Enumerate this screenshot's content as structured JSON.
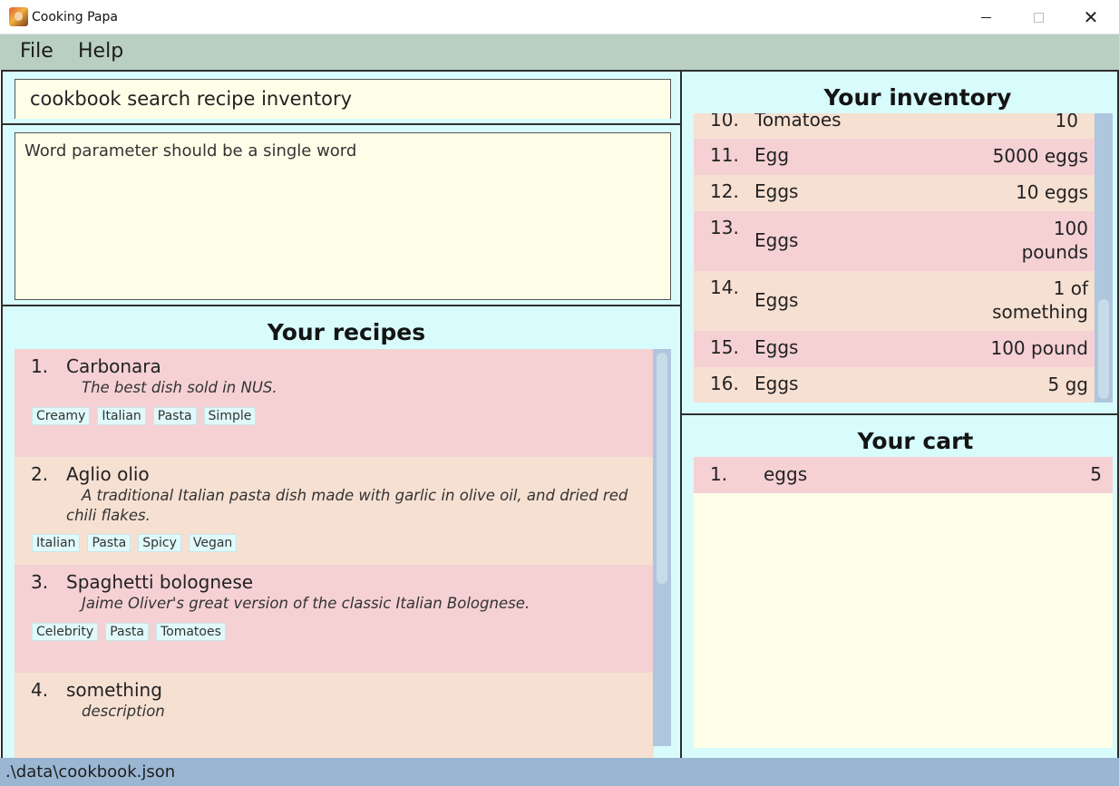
{
  "window": {
    "title": "Cooking Papa",
    "close_glyph": "✕"
  },
  "menu": {
    "file": "File",
    "help": "Help"
  },
  "command": {
    "value": "cookbook search recipe inventory"
  },
  "result": {
    "message": "Word parameter should be a single word"
  },
  "recipes": {
    "heading": "Your recipes",
    "items": [
      {
        "index": "1.",
        "name": "Carbonara",
        "description": "The best dish sold in NUS.",
        "tags": [
          "Creamy",
          "Italian",
          "Pasta",
          "Simple"
        ]
      },
      {
        "index": "2.",
        "name": "Aglio olio",
        "description": "A traditional Italian pasta dish made with garlic in olive oil, and dried red chili flakes.",
        "tags": [
          "Italian",
          "Pasta",
          "Spicy",
          "Vegan"
        ]
      },
      {
        "index": "3.",
        "name": "Spaghetti bolognese",
        "description": "Jaime Oliver's great version of the classic Italian Bolognese.",
        "tags": [
          "Celebrity",
          "Pasta",
          "Tomatoes"
        ]
      },
      {
        "index": "4.",
        "name": "something",
        "description": "description",
        "tags": []
      }
    ]
  },
  "inventory": {
    "heading": "Your inventory",
    "items": [
      {
        "index": "10.",
        "name": "Tomatoes",
        "qty": "10"
      },
      {
        "index": "11.",
        "name": "Egg",
        "qty": "5000 eggs"
      },
      {
        "index": "12.",
        "name": "Eggs",
        "qty": "10 eggs"
      },
      {
        "index": "13.",
        "name": "Eggs",
        "qty": "100 pounds",
        "qty_lines": [
          "100",
          "pounds"
        ]
      },
      {
        "index": "14.",
        "name": "Eggs",
        "qty": "1 of something",
        "qty_lines": [
          "1 of",
          "something"
        ]
      },
      {
        "index": "15.",
        "name": "Eggs",
        "qty": "100 pound"
      },
      {
        "index": "16.",
        "name": "Eggs",
        "qty": "5 gg"
      }
    ]
  },
  "cart": {
    "heading": "Your cart",
    "items": [
      {
        "index": "1.",
        "name": "eggs",
        "qty": "5"
      }
    ]
  },
  "status": {
    "path": ".\\data\\cookbook.json"
  },
  "colors": {
    "menubar": "#b9cfc2",
    "panel_bg": "#d8fbfc",
    "card_pink": "#f5d1d4",
    "card_peach": "#f6e0d2",
    "input_bg": "#fefee8",
    "statusbar": "#9ab6d2"
  }
}
